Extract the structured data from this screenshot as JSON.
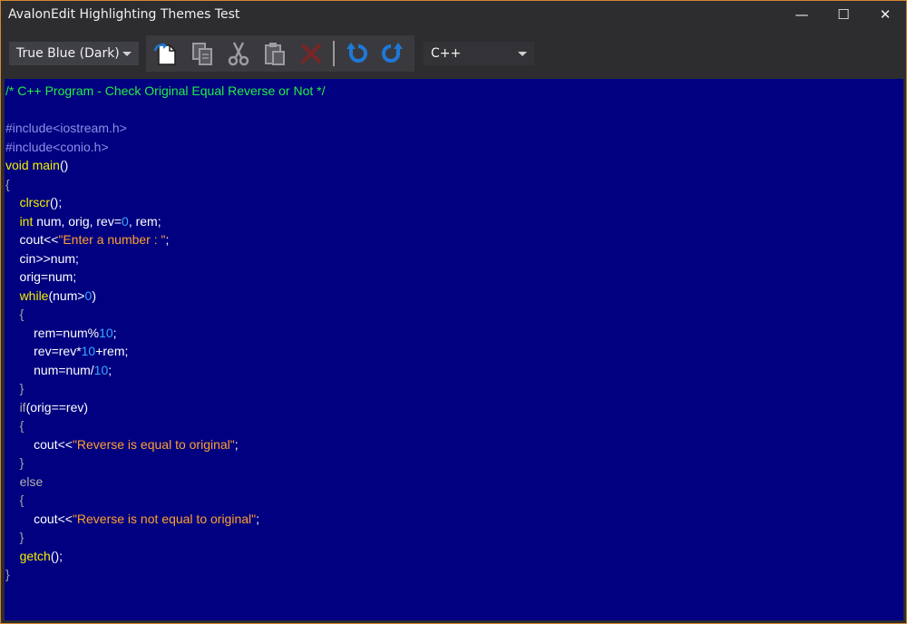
{
  "window": {
    "title": "AvalonEdit Highlighting Themes Test",
    "minimize_glyph": "—",
    "maximize_glyph": "☐",
    "close_glyph": "✕"
  },
  "toolbar": {
    "theme_selected": "True Blue (Dark)",
    "language_selected": "C++",
    "buttons": [
      {
        "name": "open-file-icon"
      },
      {
        "name": "copy-icon"
      },
      {
        "name": "cut-icon"
      },
      {
        "name": "paste-icon"
      },
      {
        "name": "delete-icon"
      },
      {
        "name": "undo-icon"
      },
      {
        "name": "redo-icon"
      }
    ]
  },
  "colors": {
    "editor_background": "#000080",
    "comment": "#22ee44",
    "preprocessor": "#8f8fe6",
    "keyword": "#f4f000",
    "number": "#35aaff",
    "string": "#ffa031",
    "window_border": "#d4872f"
  },
  "code": {
    "lines": [
      [
        {
          "t": "c-comment",
          "v": "/* C++ Program - Check Original Equal Reverse or Not */"
        }
      ],
      [],
      [
        {
          "t": "c-pre",
          "v": "#include<iostream.h>"
        }
      ],
      [
        {
          "t": "c-pre",
          "v": "#include<conio.h>"
        }
      ],
      [
        {
          "t": "c-kw",
          "v": "void"
        },
        {
          "t": "",
          "v": " "
        },
        {
          "t": "c-kw",
          "v": "main"
        },
        {
          "t": "",
          "v": "()"
        }
      ],
      [
        {
          "t": "c-brace",
          "v": "{"
        }
      ],
      [
        {
          "t": "",
          "v": "    "
        },
        {
          "t": "c-kw",
          "v": "clrscr"
        },
        {
          "t": "",
          "v": "();"
        }
      ],
      [
        {
          "t": "",
          "v": "    "
        },
        {
          "t": "c-kw",
          "v": "int"
        },
        {
          "t": "",
          "v": " num, orig, rev="
        },
        {
          "t": "c-num",
          "v": "0"
        },
        {
          "t": "",
          "v": ", rem;"
        }
      ],
      [
        {
          "t": "",
          "v": "    cout<<"
        },
        {
          "t": "c-str",
          "v": "\"Enter a number : \""
        },
        {
          "t": "",
          "v": ";"
        }
      ],
      [
        {
          "t": "",
          "v": "    cin>>num;"
        }
      ],
      [
        {
          "t": "",
          "v": "    orig=num;"
        }
      ],
      [
        {
          "t": "",
          "v": "    "
        },
        {
          "t": "c-kw",
          "v": "while"
        },
        {
          "t": "",
          "v": "(num>"
        },
        {
          "t": "c-num",
          "v": "0"
        },
        {
          "t": "",
          "v": ")"
        }
      ],
      [
        {
          "t": "",
          "v": "    "
        },
        {
          "t": "c-brace",
          "v": "{"
        }
      ],
      [
        {
          "t": "",
          "v": "        rem=num%"
        },
        {
          "t": "c-num",
          "v": "10"
        },
        {
          "t": "",
          "v": ";"
        }
      ],
      [
        {
          "t": "",
          "v": "        rev=rev*"
        },
        {
          "t": "c-num",
          "v": "10"
        },
        {
          "t": "",
          "v": "+rem;"
        }
      ],
      [
        {
          "t": "",
          "v": "        num=num/"
        },
        {
          "t": "c-num",
          "v": "10"
        },
        {
          "t": "",
          "v": ";"
        }
      ],
      [
        {
          "t": "",
          "v": "    "
        },
        {
          "t": "c-brace",
          "v": "}"
        }
      ],
      [
        {
          "t": "",
          "v": "    "
        },
        {
          "t": "c-ctl",
          "v": "if"
        },
        {
          "t": "",
          "v": "(orig==rev)"
        }
      ],
      [
        {
          "t": "",
          "v": "    "
        },
        {
          "t": "c-brace",
          "v": "{"
        }
      ],
      [
        {
          "t": "",
          "v": "        cout<<"
        },
        {
          "t": "c-str",
          "v": "\"Reverse is equal to original\""
        },
        {
          "t": "",
          "v": ";"
        }
      ],
      [
        {
          "t": "",
          "v": "    "
        },
        {
          "t": "c-brace",
          "v": "}"
        }
      ],
      [
        {
          "t": "",
          "v": "    "
        },
        {
          "t": "c-ctl",
          "v": "else"
        }
      ],
      [
        {
          "t": "",
          "v": "    "
        },
        {
          "t": "c-brace",
          "v": "{"
        }
      ],
      [
        {
          "t": "",
          "v": "        cout<<"
        },
        {
          "t": "c-str",
          "v": "\"Reverse is not equal to original\""
        },
        {
          "t": "",
          "v": ";"
        }
      ],
      [
        {
          "t": "",
          "v": "    "
        },
        {
          "t": "c-brace",
          "v": "}"
        }
      ],
      [
        {
          "t": "",
          "v": "    "
        },
        {
          "t": "c-kw",
          "v": "getch"
        },
        {
          "t": "",
          "v": "();"
        }
      ],
      [
        {
          "t": "c-brace",
          "v": "}"
        }
      ]
    ]
  }
}
